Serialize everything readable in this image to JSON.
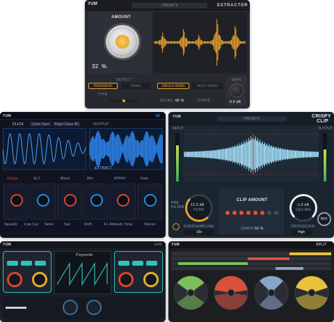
{
  "brand": "YUM",
  "extractor": {
    "title": "EXTRACTOR",
    "presets_label": "PRESETS",
    "amount_label": "AMOUNT",
    "amount_value": "32",
    "amount_unit": "%",
    "detect_label": "DETECT",
    "mode_transient": "TRANSIENT",
    "mode_tonal": "TONAL",
    "mode_single_band": "SINGLE BAND",
    "mode_multi_band": "MULTI BAND",
    "type_label": "TYPE",
    "detail_label": "DETAIL",
    "detail_value": "-95 %",
    "shape_label": "SHAPE",
    "gain_label": "GAIN",
    "gain_value": "0.0 dB",
    "accent": "#f2a62b"
  },
  "multiband": {
    "title": "UI",
    "click_label": "CLICK",
    "preset_a": "Globe Hard",
    "preset_b": "Bright Glass BD",
    "output_label": "OUTPUT",
    "modules": [
      "Shape",
      "ALT",
      "Wave",
      "Mix",
      "SPRAY",
      "Gate"
    ],
    "labels_row": [
      "Squash",
      "Low Cut",
      "Tame",
      "Sat",
      "Drift",
      "Fx Amount",
      "Tone",
      "Stereo"
    ],
    "extract_label": "EXTRACT",
    "accent": "#1f8fe8",
    "accent2": "#e2452f"
  },
  "clip": {
    "title_line1": "CRISPY",
    "title_line2": "CLIP",
    "presets_label": "PRESETS",
    "input_label": "INPUT",
    "output_label": "OUTPUT",
    "pre_filter_label": "PRE FILTER",
    "push_label": "PUSH",
    "push_value": "12.3 dB",
    "oversampling_label": "OVERSAMPLING",
    "oversampling_value": "16x",
    "clip_amount_label": "CLIP AMOUNT",
    "shape_label": "SHAPE",
    "shape_value": "56 %",
    "ceiling_label": "CEILING",
    "ceiling_value": "-1.0 dB",
    "crossover_label": "CROSSOVER",
    "crossover_value": "High",
    "mix_label": "MIX",
    "accent": "#e8a23b",
    "accent2": "#e1512f"
  },
  "osc": {
    "title": "LFO",
    "playmode_label": "Playmode",
    "accent": "#2ec4b6",
    "accent2": "#e8b02a"
  },
  "split": {
    "title": "SPLIT",
    "accent": "#e8c33a",
    "band_colors": [
      "#7bbf5a",
      "#d9513a",
      "#8aa4c8",
      "#e8c33a"
    ]
  }
}
